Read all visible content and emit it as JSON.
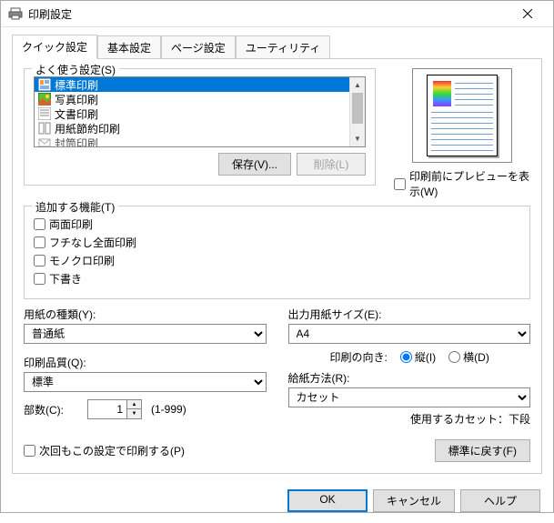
{
  "window": {
    "title": "印刷設定"
  },
  "tabs": [
    "クイック設定",
    "基本設定",
    "ページ設定",
    "ユーティリティ"
  ],
  "presets": {
    "legend": "よく使う設定(S)",
    "items": [
      "標準印刷",
      "写真印刷",
      "文書印刷",
      "用紙節約印刷",
      "封筒印刷"
    ],
    "save_btn": "保存(V)...",
    "delete_btn": "削除(L)"
  },
  "preview": {
    "show_label": "印刷前にプレビューを表示(W)"
  },
  "features": {
    "legend": "追加する機能(T)",
    "items": [
      "両面印刷",
      "フチなし全面印刷",
      "モノクロ印刷",
      "下書き"
    ]
  },
  "media": {
    "label": "用紙の種類(Y):",
    "value": "普通紙"
  },
  "quality": {
    "label": "印刷品質(Q):",
    "value": "標準"
  },
  "copies": {
    "label": "部数(C):",
    "value": "1",
    "range": "(1-999)"
  },
  "output_size": {
    "label": "出力用紙サイズ(E):",
    "value": "A4"
  },
  "orientation": {
    "label": "印刷の向き:",
    "portrait": "縦(I)",
    "landscape": "横(D)"
  },
  "source": {
    "label": "給紙方法(R):",
    "value": "カセット",
    "info": "使用するカセット：下段"
  },
  "remember": {
    "label": "次回もこの設定で印刷する(P)"
  },
  "reset_btn": "標準に戻す(F)",
  "buttons": {
    "ok": "OK",
    "cancel": "キャンセル",
    "help": "ヘルプ"
  }
}
